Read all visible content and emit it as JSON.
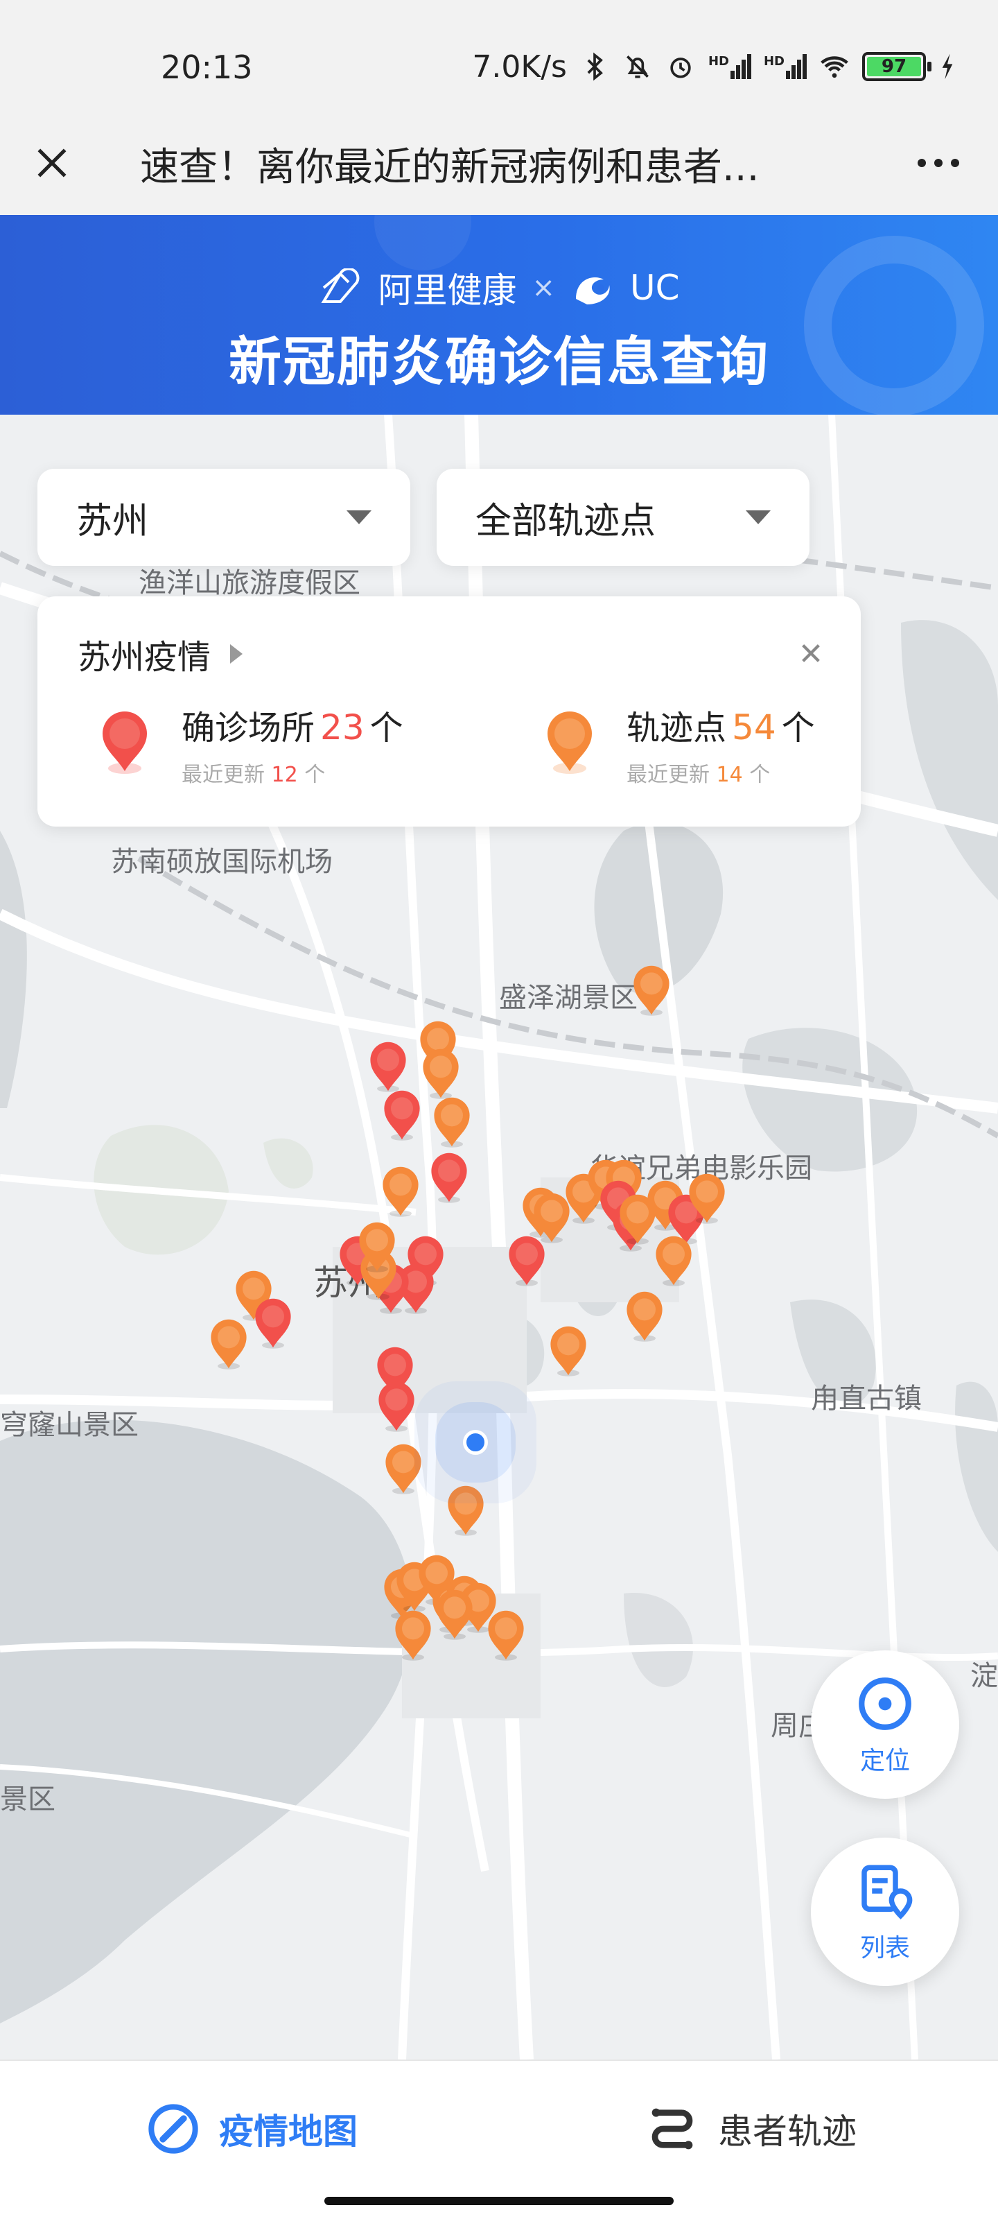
{
  "status_bar": {
    "time": "20:13",
    "net_speed": "7.0K/s",
    "signal_label": "HD",
    "battery": "97",
    "icons": [
      "bluetooth-icon",
      "bell-off-icon",
      "alarm-icon",
      "signal-icon",
      "signal-icon",
      "wifi-icon",
      "battery-icon",
      "charging-icon"
    ]
  },
  "nav": {
    "title": "速查！离你最近的新冠病例和患者...",
    "close_icon": "close-icon",
    "more_icon": "more-icon"
  },
  "banner": {
    "brand1": "阿里健康",
    "times": "×",
    "brand2": "UC",
    "title": "新冠肺炎确诊信息查询"
  },
  "filters": {
    "city": "苏州",
    "type": "全部轨迹点"
  },
  "info_card": {
    "title": "苏州疫情",
    "confirmed": {
      "label": "确诊场所",
      "count": "23",
      "unit": "个",
      "updated_label": "最近更新",
      "updated": "12",
      "updated_unit": "个"
    },
    "track": {
      "label": "轨迹点",
      "count": "54",
      "unit": "个",
      "updated_label": "最近更新",
      "updated": "14",
      "updated_unit": "个"
    }
  },
  "map": {
    "labels": {
      "resort": "渔洋山旅游度假区",
      "airport": "苏南硕放国际机场",
      "lake_resort": "盛泽湖景区",
      "studio": "华谊兄弟电影乐园",
      "city": "苏州",
      "qionglong": "穹窿山景区",
      "luzhi": "甪直古镇",
      "zhou": "周庄",
      "dian": "淀",
      "jing": "景区"
    }
  },
  "fab": {
    "locate": "定位",
    "list": "列表"
  },
  "tabs": {
    "map": "疫情地图",
    "track": "患者轨迹"
  },
  "colors": {
    "primary": "#2f7df5",
    "confirmed": "#f2504b",
    "track": "#f5893a",
    "banner": "#2a6ee8"
  }
}
